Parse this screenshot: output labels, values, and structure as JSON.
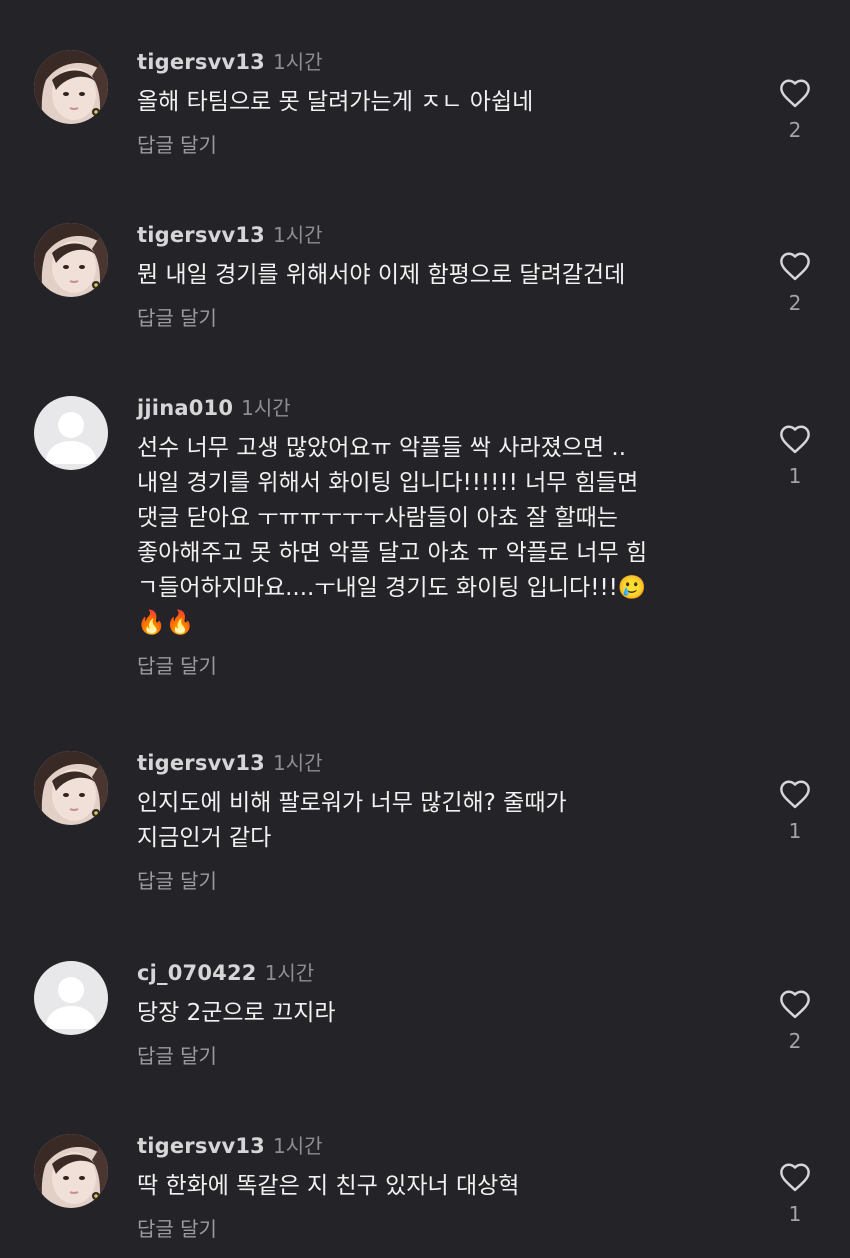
{
  "comments": [
    {
      "username": "tigersvv13",
      "time": "1시간",
      "text": "올해 타팀으로 못 달려가는게 ㅈㄴ 아쉽네",
      "reply": "답글 달기",
      "likes": "2",
      "avatar": "photo"
    },
    {
      "username": "tigersvv13",
      "time": "1시간",
      "text": "뭔 내일 경기를 위해서야 이제 함평으로 달려갈건데",
      "reply": "답글 달기",
      "likes": "2",
      "avatar": "photo"
    },
    {
      "username": "jjina010",
      "time": "1시간",
      "text": "선수 너무 고생 많았어요ㅠ 악플들 싹 사라졌으면 ..\n내일 경기를 위해서 화이팅 입니다!!!!!! 너무 힘들면\n댓글 닫아요 ㅜㅠㅠㅜㅜㅜ사람들이 아쵸 잘 할때는\n좋아해주고 못 하면 악플 달고 아쵸 ㅠ 악플로 너무 힘\nㄱ들어하지마요....ㅜ내일 경기도 화이팅 입니다!!!🥲\n🔥🔥",
      "reply": "답글 달기",
      "likes": "1",
      "avatar": "default"
    },
    {
      "username": "tigersvv13",
      "time": "1시간",
      "text": "인지도에 비해 팔로워가 너무 많긴해? 줄때가\n지금인거 같다",
      "reply": "답글 달기",
      "likes": "1",
      "avatar": "photo"
    },
    {
      "username": "cj_070422",
      "time": "1시간",
      "text": "당장 2군으로 끄지라",
      "reply": "답글 달기",
      "likes": "2",
      "avatar": "default"
    },
    {
      "username": "tigersvv13",
      "time": "1시간",
      "text": "딱 한화에 똑같은 지 친구 있자너 대상혁",
      "reply": "답글 달기",
      "likes": "1",
      "avatar": "photo"
    }
  ],
  "icons": {
    "like": "heart-outline-icon",
    "default_avatar": "default-user-icon"
  },
  "colors": {
    "background": "#242428",
    "text": "#f1f1f1",
    "username": "#d6d6d8",
    "muted": "#8d8d92"
  }
}
